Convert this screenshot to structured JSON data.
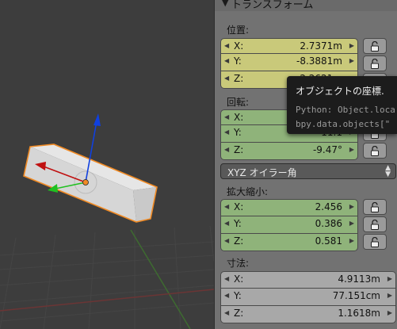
{
  "panel": {
    "title": "トランスフォーム",
    "location": {
      "label": "位置:",
      "rows": [
        {
          "axis": "X:",
          "value": "2.7371m"
        },
        {
          "axis": "Y:",
          "value": "-8.3881m"
        },
        {
          "axis": "Z:",
          "value": "2.2621m"
        }
      ]
    },
    "rotation": {
      "label": "回転:",
      "rows": [
        {
          "axis": "X:",
          "value": ""
        },
        {
          "axis": "Y:",
          "value": "11.1"
        },
        {
          "axis": "Z:",
          "value": "-9.47°"
        }
      ]
    },
    "rotation_mode": {
      "value": "XYZ オイラー角"
    },
    "scale": {
      "label": "拡大縮小:",
      "rows": [
        {
          "axis": "X:",
          "value": "2.456"
        },
        {
          "axis": "Y:",
          "value": "0.386"
        },
        {
          "axis": "Z:",
          "value": "0.581"
        }
      ]
    },
    "dimensions": {
      "label": "寸法:",
      "rows": [
        {
          "axis": "X:",
          "value": "4.9113m"
        },
        {
          "axis": "Y:",
          "value": "77.151cm"
        },
        {
          "axis": "Z:",
          "value": "1.1618m"
        }
      ]
    }
  },
  "tooltip": {
    "title": "オブジェクトの座標.",
    "line1": "Python: Object.loca",
    "line2": "bpy.data.objects[\""
  },
  "colors": {
    "location_field": "#c9c97a",
    "rotation_field": "#8fb37a",
    "scale_field": "#8fb37a",
    "dimension_field": "#a8a8a8",
    "axis_x": "#c01010",
    "axis_y": "#20c020",
    "axis_z": "#1040e0",
    "selection_outline": "#f08a24"
  },
  "icons": {
    "lock": "lock-open-icon",
    "header": "triangle-down-icon",
    "dropdown": "up-down-arrows-icon"
  }
}
